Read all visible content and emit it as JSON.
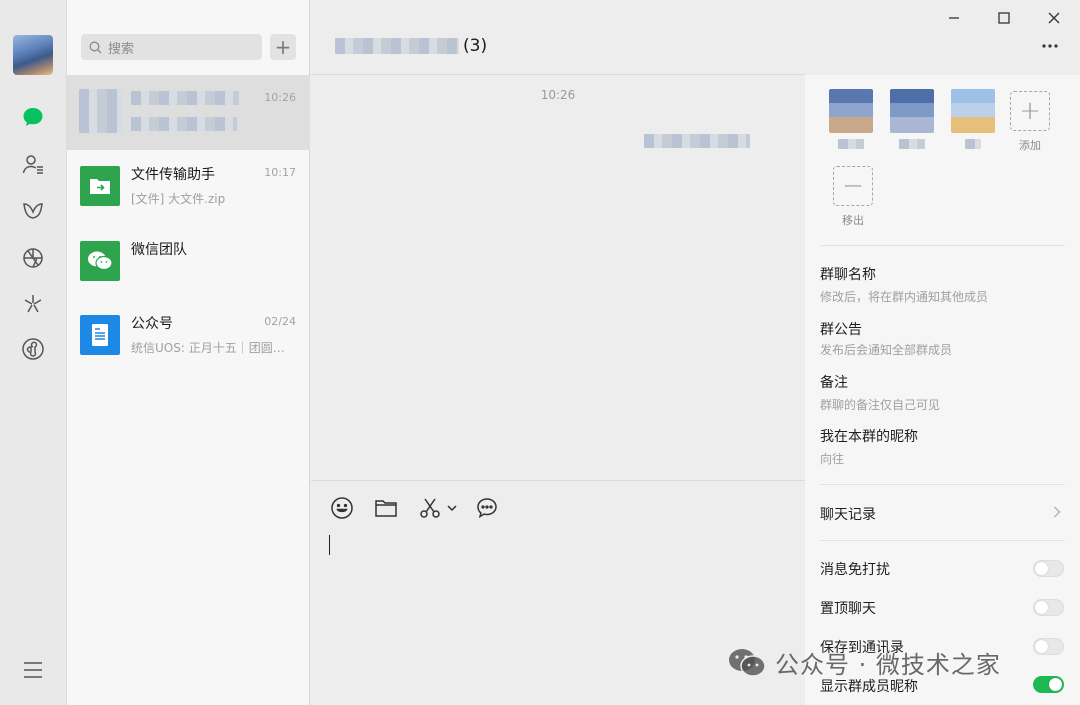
{
  "list": {
    "search_placeholder": "搜索",
    "conversations": [
      {
        "name": "",
        "time": "10:26",
        "preview": ""
      },
      {
        "name": "文件传输助手",
        "time": "10:17",
        "preview": "[文件] 大文件.zip"
      },
      {
        "name": "微信团队",
        "time": "",
        "preview": ""
      },
      {
        "name": "公众号",
        "time": "02/24",
        "preview": "统信UOS: 正月十五｜团圆…"
      }
    ]
  },
  "chat": {
    "title_suffix": "(3)",
    "timestamp": "10:26"
  },
  "panel": {
    "add_label": "添加",
    "remove_label": "移出",
    "group_name_title": "群聊名称",
    "group_name_sub": "修改后，将在群内通知其他成员",
    "notice_title": "群公告",
    "notice_sub": "发布后会通知全部群成员",
    "remark_title": "备注",
    "remark_sub": "群聊的备注仅自己可见",
    "nickname_title": "我在本群的昵称",
    "nickname_sub": "向往",
    "history": "聊天记录",
    "mute": "消息免打扰",
    "pin": "置顶聊天",
    "save_contacts": "保存到通讯录",
    "show_nicknames": "显示群成员昵称",
    "toggles": {
      "mute": false,
      "pin": false,
      "save_contacts": false,
      "show_nicknames": true
    }
  },
  "watermark": "公众号 · 微技术之家",
  "icons": {
    "chat": "chat-bubble-icon",
    "contacts": "contacts-icon",
    "favorites": "favorites-icon",
    "moments": "moments-icon",
    "channels": "channels-icon",
    "miniprogram": "mini-program-icon",
    "menu": "menu-icon"
  },
  "colors": {
    "accent": "#07c160",
    "toggle_on": "#1fb954",
    "file_helper": "#2ea44f",
    "official": "#1e88e5"
  }
}
